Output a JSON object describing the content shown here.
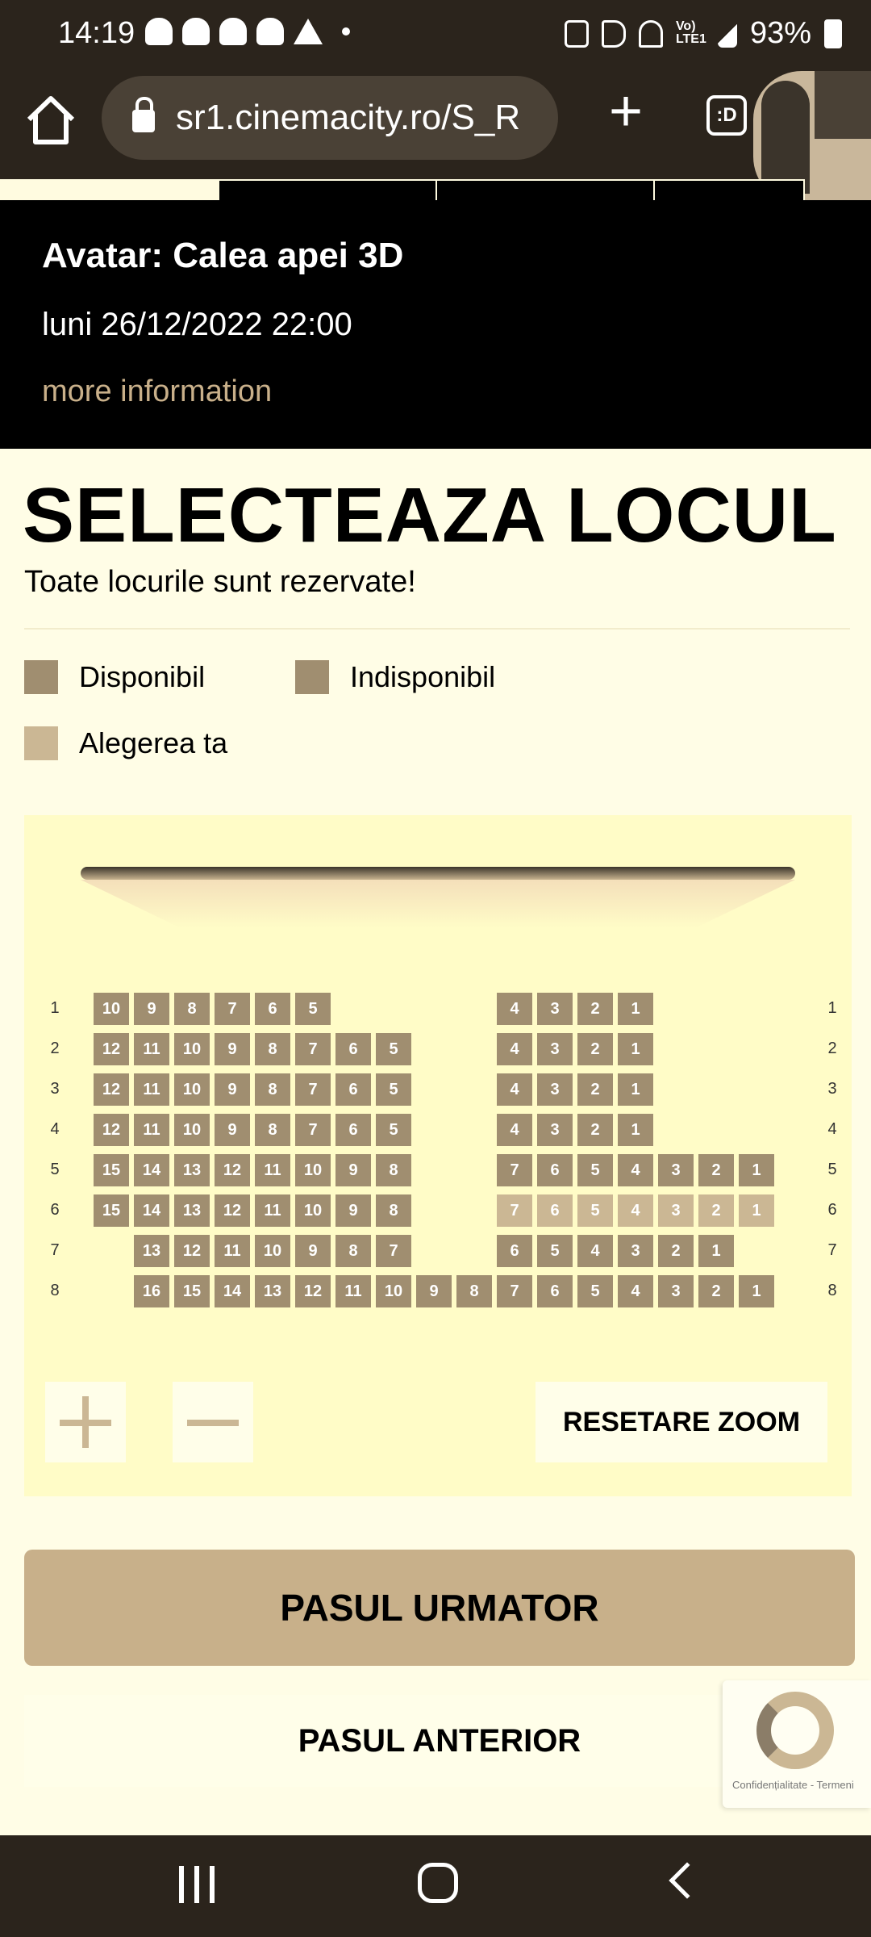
{
  "status": {
    "time": "14:19",
    "battery": "93%",
    "icons": [
      "snapchat-icon",
      "snapchat-icon",
      "snapchat-icon",
      "snapchat-icon",
      "warning-icon",
      "dot-icon",
      "battery-saver-icon",
      "mute-icon",
      "wifi-icon",
      "volte-icon",
      "signal-icon",
      "battery-icon"
    ]
  },
  "browser": {
    "url": "sr1.cinemacity.ro/S_R",
    "icons": [
      "home-icon",
      "lock-icon",
      "new-tab-icon",
      "tab-switcher-icon",
      "profile-avatar"
    ],
    "tab_switcher_label": ":D"
  },
  "steps": {
    "total": 4,
    "active": 1
  },
  "movie": {
    "title": "Avatar: Calea apei 3D",
    "datetime": "luni 26/12/2022 22:00",
    "more_info": "more information"
  },
  "page": {
    "title": "SELECTEAZA LOCUL",
    "subtitle": "Toate locurile sunt rezervate!"
  },
  "legend": [
    {
      "label": "Disponibil",
      "color": "#a08e70"
    },
    {
      "label": "Indisponibil",
      "color": "#a08e70"
    },
    {
      "label": "Alegerea ta",
      "color": "#cbb794"
    }
  ],
  "seat_map": {
    "rows": [
      {
        "row": "1",
        "left": [
          "10",
          "9",
          "8",
          "7",
          "6",
          "5"
        ],
        "mid": [],
        "right": [
          "4",
          "3",
          "2",
          "1"
        ]
      },
      {
        "row": "2",
        "left": [
          "12",
          "11",
          "10",
          "9",
          "8",
          "7",
          "6",
          "5"
        ],
        "mid": [],
        "right": [
          "4",
          "3",
          "2",
          "1"
        ]
      },
      {
        "row": "3",
        "left": [
          "12",
          "11",
          "10",
          "9",
          "8",
          "7",
          "6",
          "5"
        ],
        "mid": [],
        "right": [
          "4",
          "3",
          "2",
          "1"
        ]
      },
      {
        "row": "4",
        "left": [
          "12",
          "11",
          "10",
          "9",
          "8",
          "7",
          "6",
          "5"
        ],
        "mid": [],
        "right": [
          "4",
          "3",
          "2",
          "1"
        ]
      },
      {
        "row": "5",
        "left": [
          "15",
          "14",
          "13",
          "12",
          "11",
          "10",
          "9",
          "8"
        ],
        "mid": [],
        "right": [
          "7",
          "6",
          "5",
          "4",
          "3",
          "2",
          "1"
        ]
      },
      {
        "row": "6",
        "left": [
          "15",
          "14",
          "13",
          "12",
          "11",
          "10",
          "9",
          "8"
        ],
        "mid": [],
        "right": [
          "7",
          "6",
          "5",
          "4",
          "3",
          "2",
          "1"
        ],
        "selected_right": true
      },
      {
        "row": "7",
        "left": [
          "13",
          "12",
          "11",
          "10",
          "9",
          "8",
          "7"
        ],
        "mid": [],
        "right": [
          "6",
          "5",
          "4",
          "3",
          "2",
          "1"
        ]
      },
      {
        "row": "8",
        "left": [
          "16",
          "15",
          "14",
          "13",
          "12",
          "11",
          "10"
        ],
        "mid": [
          "9",
          "8"
        ],
        "right": [
          "7",
          "6",
          "5",
          "4",
          "3",
          "2",
          "1"
        ]
      }
    ]
  },
  "controls": {
    "reset_zoom": "RESETARE ZOOM",
    "zoom_in_icon": "plus-icon",
    "zoom_out_icon": "minus-icon"
  },
  "actions": {
    "next": "PASUL URMATOR",
    "prev": "PASUL ANTERIOR"
  },
  "recaptcha": {
    "text": "Confidențialitate - Termeni",
    "icon": "recaptcha-icon"
  },
  "nav": {
    "icons": [
      "recents-icon",
      "home-icon",
      "back-icon"
    ]
  }
}
